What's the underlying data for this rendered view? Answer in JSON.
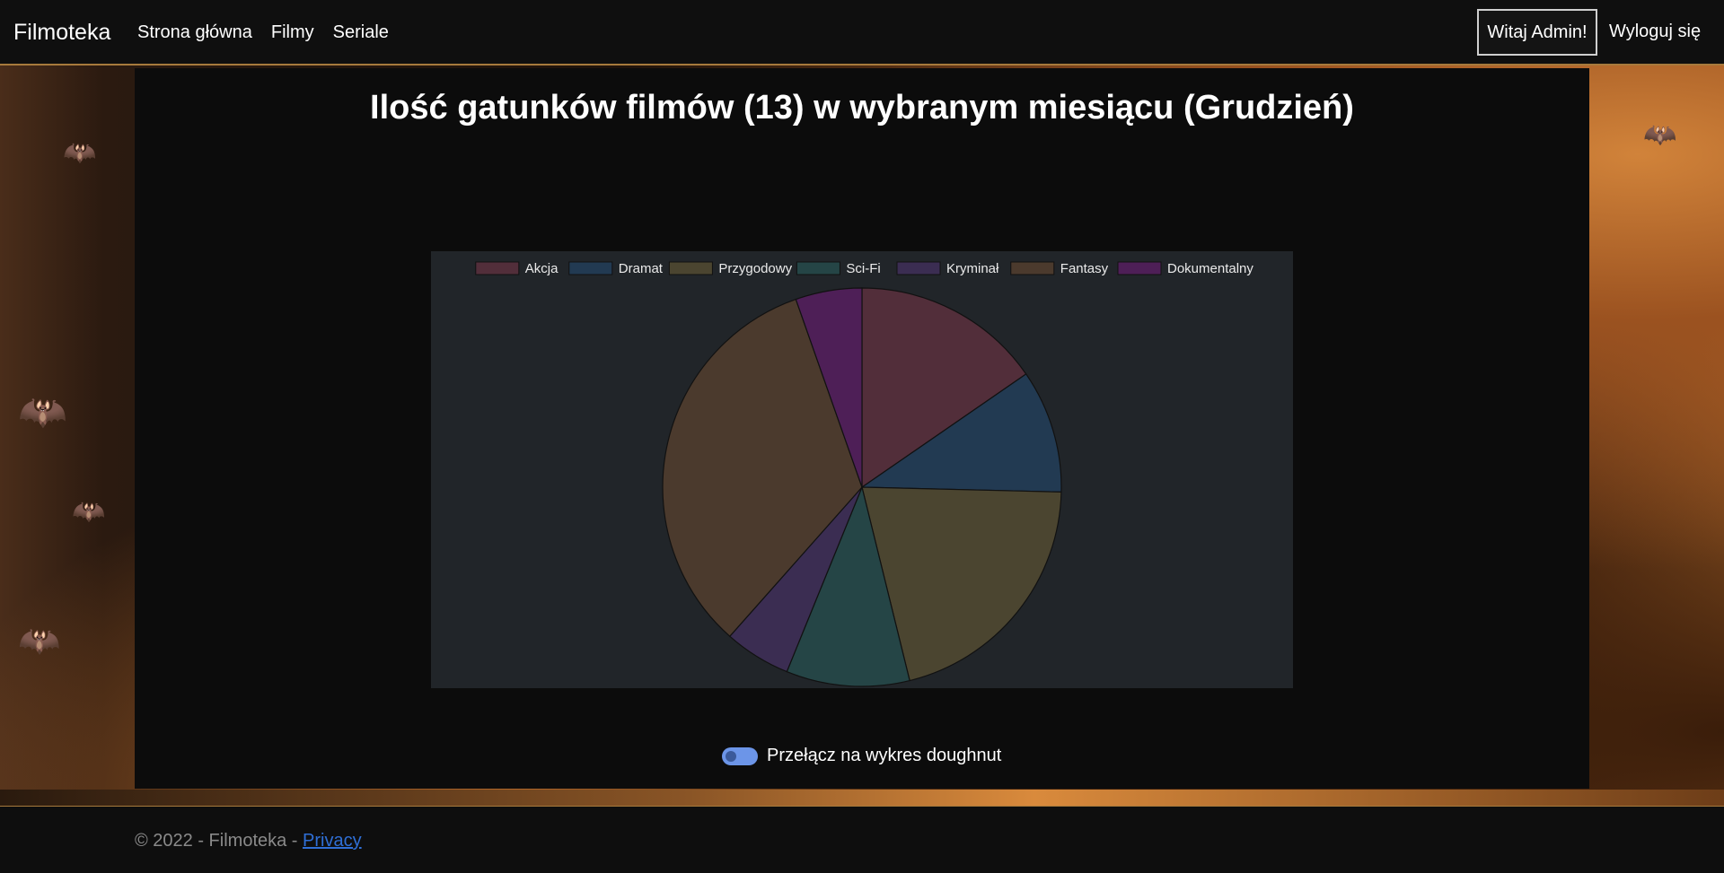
{
  "navbar": {
    "brand": "Filmoteka",
    "links": [
      "Strona główna",
      "Filmy",
      "Seriale"
    ],
    "greeting": "Witaj Admin!",
    "logout": "Wyloguj się"
  },
  "page": {
    "title": "Ilość gatunków filmów (13) w wybranym miesiącu (Grudzień)",
    "toggle_label": "Przełącz na wykres doughnut",
    "toggle_on": true
  },
  "footer": {
    "copyright": "© 2022 - Filmoteka - ",
    "privacy": "Privacy"
  },
  "colors": {
    "accent": "#a77a3c",
    "chart_bg": "#212529",
    "link": "#2f6fd6"
  },
  "chart_data": {
    "type": "pie",
    "title": "",
    "legend_position": "top",
    "categories": [
      "Akcja",
      "Dramat",
      "Przygodowy",
      "Sci-Fi",
      "Kryminał",
      "Fantasy",
      "Dokumentalny"
    ],
    "values": [
      2,
      1.3,
      2.7,
      1.3,
      0.7,
      4.3,
      0.7
    ],
    "colors": [
      "#522e3a",
      "#223a52",
      "#4b4530",
      "#254546",
      "#3b2d52",
      "#4b3a2d",
      "#4e1f57"
    ]
  }
}
